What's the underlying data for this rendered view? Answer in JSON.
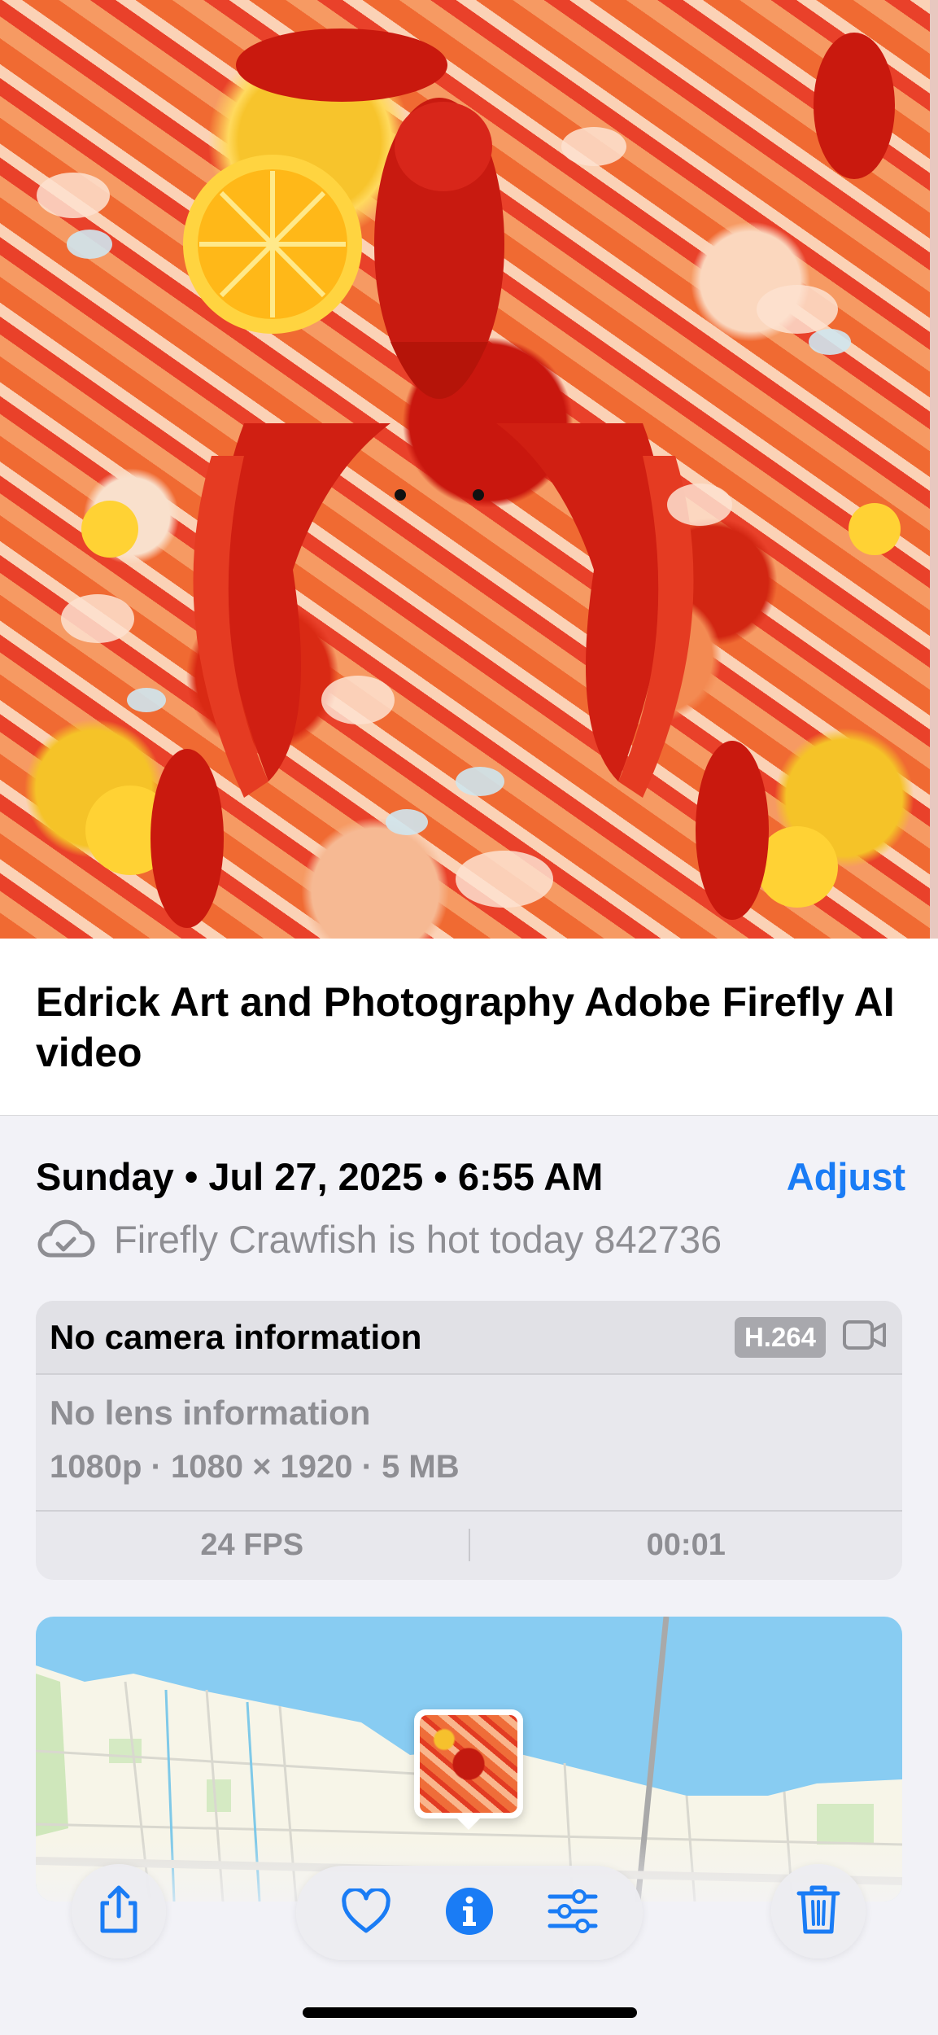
{
  "media": {
    "description_icon": "crawfish-artwork"
  },
  "title": {
    "text": "Edrick Art and Photography Adobe Firefly AI video"
  },
  "info": {
    "date_text": "Sunday • Jul 27, 2025 • 6:55 AM",
    "adjust_label": "Adjust",
    "caption_icon": "icloud-check-icon",
    "caption_text": "Firefly Crawfish is hot today 842736"
  },
  "camera_card": {
    "camera_title": "No camera information",
    "codec_badge": "H.264",
    "video_icon": "video-camera-icon",
    "lens_text": "No lens information",
    "specs_text": "1080p · 1080 × 1920 · 5 MB",
    "fps": "24 FPS",
    "duration": "00:01"
  },
  "map": {
    "pin_icon": "photo-thumbnail-pin"
  },
  "toolbar": {
    "share_icon": "share-icon",
    "favorite_icon": "heart-icon",
    "info_icon": "info-icon",
    "edit_icon": "sliders-icon",
    "delete_icon": "trash-icon"
  },
  "colors": {
    "accent": "#1a7cf5",
    "background": "#f2f2f7",
    "secondary_text": "#8e8e93"
  }
}
